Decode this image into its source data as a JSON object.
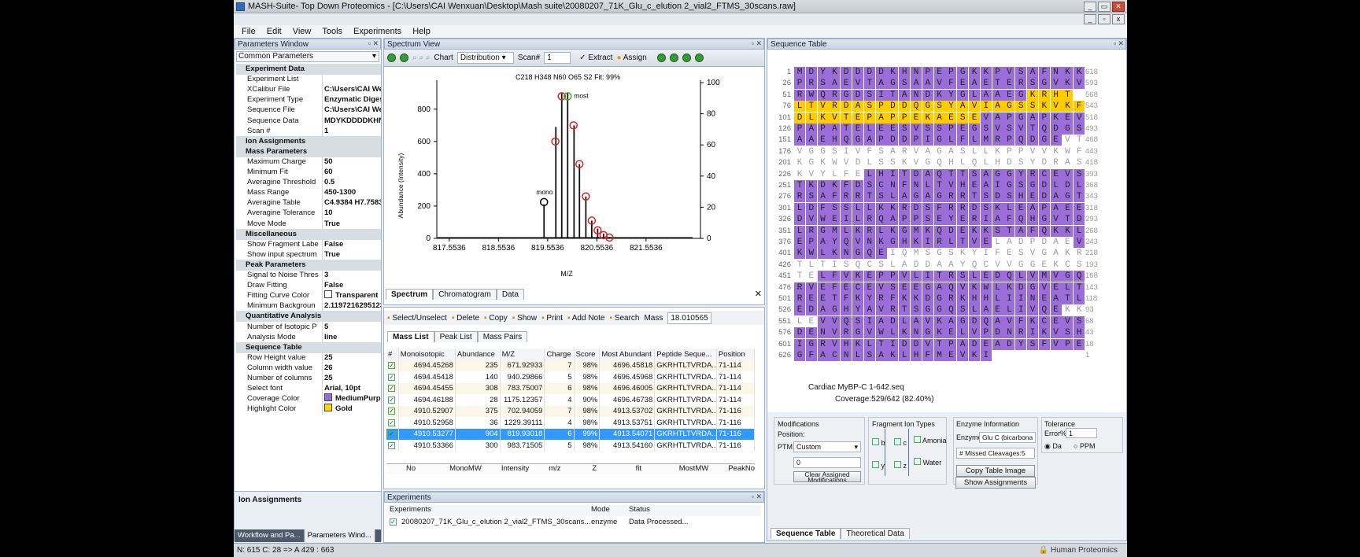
{
  "window": {
    "title": "MASH-Suite- Top Down Proteomics - [C:\\Users\\CAI Wenxuan\\Desktop\\Mash suite\\20080207_71K_Glu_c_elution 2_vial2_FTMS_30scans.raw]"
  },
  "menu": [
    "File",
    "Edit",
    "View",
    "Tools",
    "Experiments",
    "Help"
  ],
  "params": {
    "title": "Parameters Window",
    "dropdown": "Common Parameters",
    "rows": [
      {
        "s": "Experiment Data"
      },
      {
        "k": "Experiment List",
        "v": ""
      },
      {
        "k": "XCalibur File",
        "v": "C:\\Users\\CAI Wen"
      },
      {
        "k": "Experiment Type",
        "v": "Enzymatic Digesti"
      },
      {
        "k": "Sequence File",
        "v": "C:\\Users\\CAI Wen"
      },
      {
        "k": "Sequence Data",
        "v": "MDYKDDDDKHNI"
      },
      {
        "k": "Scan #",
        "v": "1"
      },
      {
        "s": "Ion Assignments"
      },
      {
        "s": "Mass Parameters"
      },
      {
        "k": "Maximum Charge",
        "v": "50"
      },
      {
        "k": "Minimum Fit",
        "v": "60"
      },
      {
        "k": "Averagine Threshold",
        "v": "0.5"
      },
      {
        "k": "Mass Range",
        "v": "450-1300"
      },
      {
        "k": "Averagine Table",
        "v": "C4.9384 H7.7583 N"
      },
      {
        "k": "Averagine Tolerance",
        "v": "10"
      },
      {
        "k": "Move Mode",
        "v": "True"
      },
      {
        "s": "Miscellaneous"
      },
      {
        "k": "Show Fragment Labe",
        "v": "False"
      },
      {
        "k": "Show input spectrum",
        "v": "True"
      },
      {
        "s": "Peak Parameters"
      },
      {
        "k": "Signal to Noise Thres",
        "v": "3"
      },
      {
        "k": "Draw Fitting",
        "v": "False"
      },
      {
        "k": "Fitting Curve Color",
        "v": "Transparent",
        "sw": "#ffffff"
      },
      {
        "k": "Minimum Backgroun",
        "v": "2.11972162951238"
      },
      {
        "s": "Quantitative Analysis"
      },
      {
        "k": "Number of Isotopic P",
        "v": "5"
      },
      {
        "k": "Analysis Mode",
        "v": "line"
      },
      {
        "s": "Sequence Table"
      },
      {
        "k": "Row Height value",
        "v": "25"
      },
      {
        "k": "Column width value",
        "v": "26"
      },
      {
        "k": "Number of columns",
        "v": "25"
      },
      {
        "k": "Select font",
        "v": "Arial, 10pt"
      },
      {
        "k": "Coverage Color",
        "v": "MediumPurple",
        "sw": "#9370db"
      },
      {
        "k": "Highlight Color",
        "v": "Gold",
        "sw": "#ffd700"
      }
    ],
    "ion_box": "Ion Assignments",
    "tabs": [
      "Workflow and Pa...",
      "Parameters Wind..."
    ]
  },
  "spectrum": {
    "title": "Spectrum View",
    "chart_label": "Chart",
    "chart_value": "Distribution",
    "scan_label": "Scan#",
    "scan_value": "1",
    "extract": "Extract",
    "assign": "Assign",
    "formula": "C218 H348 N60 O65 S2  Fit: 99%",
    "ylabel": "Abundance (Intensity)",
    "xlabel": "M/Z",
    "most": "most",
    "mono": "mono",
    "xticks": [
      "817.5536",
      "818.5536",
      "819.5536",
      "820.5536",
      "821.5536"
    ],
    "yticks_left": [
      "0",
      "200",
      "400",
      "600",
      "800"
    ],
    "yticks_right": [
      "0",
      "20",
      "40",
      "60",
      "80",
      "100"
    ],
    "tabs": [
      "Spectrum",
      "Chromatogram",
      "Data"
    ]
  },
  "chart_data": {
    "type": "scatter",
    "x_domain": [
      817.3,
      822.5
    ],
    "y_domain": [
      0,
      950
    ],
    "sticks": [
      {
        "x": 819.48,
        "y": 210
      },
      {
        "x": 819.72,
        "y": 690
      },
      {
        "x": 819.84,
        "y": 900
      },
      {
        "x": 819.96,
        "y": 900
      },
      {
        "x": 820.09,
        "y": 700
      },
      {
        "x": 820.2,
        "y": 460
      },
      {
        "x": 820.33,
        "y": 260
      },
      {
        "x": 820.45,
        "y": 110
      },
      {
        "x": 820.57,
        "y": 60
      },
      {
        "x": 820.69,
        "y": 30
      },
      {
        "x": 820.81,
        "y": 10
      }
    ],
    "circles": [
      {
        "x": 819.48,
        "y": 225
      },
      {
        "x": 819.71,
        "y": 600
      },
      {
        "x": 819.84,
        "y": 880
      },
      {
        "x": 819.96,
        "y": 880
      },
      {
        "x": 820.08,
        "y": 700
      },
      {
        "x": 820.2,
        "y": 460
      },
      {
        "x": 820.33,
        "y": 260
      },
      {
        "x": 820.45,
        "y": 110
      },
      {
        "x": 820.57,
        "y": 50
      },
      {
        "x": 820.69,
        "y": 20
      },
      {
        "x": 820.81,
        "y": 5
      }
    ]
  },
  "mass": {
    "toolbar": [
      "Select/Unselect",
      "Delete",
      "Copy",
      "Show",
      "Print",
      "Add Note",
      "Search"
    ],
    "mass_label": "Mass",
    "mass_value": "18.010565",
    "tabs": [
      "Mass List",
      "Peak List",
      "Mass Pairs"
    ],
    "headers": [
      "#",
      "Monoisotopic",
      "Abundance",
      "M/Z",
      "Charge",
      "Score",
      "Most Abundant",
      "Peptide Seque...",
      "Position"
    ],
    "rows": [
      [
        "4694.45268",
        "235",
        "671.92933",
        "7",
        "98%",
        "4696.45818",
        "GKRHTLTVRDA...",
        "71-114"
      ],
      [
        "4694.45418",
        "140",
        "940.29866",
        "5",
        "98%",
        "4696.45968",
        "GKRHTLTVRDA...",
        "71-114"
      ],
      [
        "4694.45455",
        "308",
        "783.75007",
        "6",
        "98%",
        "4696.46005",
        "GKRHTLTVRDA...",
        "71-114"
      ],
      [
        "4694.46188",
        "28",
        "1175.12357",
        "4",
        "90%",
        "4696.46738",
        "GKRHTLTVRDA...",
        "71-114"
      ],
      [
        "4910.52907",
        "375",
        "702.94059",
        "7",
        "98%",
        "4913.53702",
        "GKRHTLTVRDA...",
        "71-116"
      ],
      [
        "4910.52958",
        "36",
        "1229.39111",
        "4",
        "98%",
        "4913.53751",
        "GKRHTLTVRDA...",
        "71-116"
      ],
      [
        "4910.53277",
        "904",
        "819.93018",
        "6",
        "99%",
        "4913.54071",
        "GKRHTLTVRDA...",
        "71-116"
      ],
      [
        "4910.53366",
        "300",
        "983.71505",
        "5",
        "98%",
        "4913.54160",
        "GKRHTLTVRDA...",
        "71-116"
      ]
    ],
    "selected_row": 6,
    "footer": [
      "No",
      "MonoMW",
      "Intensity",
      "m/z",
      "Z",
      "fit",
      "MostMW",
      "PeakNo"
    ]
  },
  "experiments": {
    "title": "Experiments",
    "headers": [
      "Experiments",
      "Mode",
      "Status"
    ],
    "row": [
      "20080207_71K_Glu_c_elution 2_vial2_FTMS_30scans...",
      "enzyme",
      "Data Processed..."
    ]
  },
  "seq": {
    "title": "Sequence Table",
    "rows": [
      {
        "n": "1",
        "r": "618",
        "s": "MDYKDDDDKHNPEPGKKPVSAFNKK",
        "m": "ccccccccccccccccccccccccc"
      },
      {
        "n": "26",
        "r": "593",
        "s": "PRSAEVTAGSAAVFEAETERSGVKV",
        "m": "ccccccccccccccccccccccccc"
      },
      {
        "n": "51",
        "r": "568",
        "s": "RWQRGDSITANDKYGLAAEGKRHT",
        "m": "cccccccccccccccccccchhhh"
      },
      {
        "n": "76",
        "r": "543",
        "s": "LTVRDASPDDQGSYAVIAGSSKVKF",
        "m": "hhhhhhhhhhhhhhhhhhhhhhhhh"
      },
      {
        "n": "101",
        "r": "518",
        "s": "DLKVTEPAPPEKAESEVAPGAPKEV",
        "m": "hhhhhhhhhhhhhhhhccccccccc"
      },
      {
        "n": "126",
        "r": "493",
        "s": "PAPATELEESVSSPEGSVSVTQDGS",
        "m": "ccccccccccccccccccccccccc"
      },
      {
        "n": "151",
        "r": "468",
        "s": "AAEHQGAPDDPIGLFLMRPQDGEVT",
        "m": "cccccccccccccccccccccccnn"
      },
      {
        "n": "176",
        "r": "443",
        "s": "VGGSIVFSARVAGASLLKPPVVKWF",
        "m": "nnnnnnnnnnnnnnnnnnnnnnnnn"
      },
      {
        "n": "201",
        "r": "418",
        "s": "KGKWVDLSSKVGQHLQLHDSYDRAS",
        "m": "nnnnnnnnnnnnnnnnnnnnnnnnn"
      },
      {
        "n": "226",
        "r": "393",
        "s": "KVYLFELHITDAQTTSAGGYRCEVS",
        "m": "nnnnnnccccccccccccccccccc"
      },
      {
        "n": "251",
        "r": "368",
        "s": "TKDKFDSCNFNLTVHEAIGSGDLDL",
        "m": "ccccccccccccccccccccccccc"
      },
      {
        "n": "276",
        "r": "343",
        "s": "RSAFRRTSLAGAGRRTSDSHEDAGT",
        "m": "ccccccccccccccccccccccccc"
      },
      {
        "n": "301",
        "r": "318",
        "s": "LDFSSLLKKRDSFRRDSKLEAPAEE",
        "m": "ccccccccccccccccccccccccc"
      },
      {
        "n": "326",
        "r": "293",
        "s": "DVWEILRQAPPSEYERIAFQHGVTD",
        "m": "ccccccccccccccccccccccccc"
      },
      {
        "n": "351",
        "r": "268",
        "s": "LRGMLKRLKGMKQDEKKSTAFQKKL",
        "m": "ccccccccccccccccccccccccc"
      },
      {
        "n": "376",
        "r": "243",
        "s": "EPAYQVNKGHKIRLTVELADPDAEV",
        "m": "cccccccccccccccccnnnnnnnc"
      },
      {
        "n": "401",
        "r": "218",
        "s": "KWLKNGQEIQMSGSKYIFESVGAKR",
        "m": "ccccccccnnnnnnnnnnnnnnnnn"
      },
      {
        "n": "426",
        "r": "193",
        "s": "TLTISQCSLADDAAYQCVVGGEKCS",
        "m": "nnnnnnnnnnnnnnnnnnnnnnnnn"
      },
      {
        "n": "451",
        "r": "168",
        "s": "TELFVKEPPVLITRSLEDQLVMVGQ",
        "m": "nnccccccccccccccccccccccc"
      },
      {
        "n": "476",
        "r": "143",
        "s": "RVEFECEVSEEGAQVKWLKDGVELT",
        "m": "ccccccccccccccccccccccccc"
      },
      {
        "n": "501",
        "r": "118",
        "s": "REETFKYRFKKDGRKHHLIINEATL",
        "m": "ccccccccccccccccccccccccc"
      },
      {
        "n": "526",
        "r": "93",
        "s": "EDAGHYAVRTSGGQSLAELIVQEKK",
        "m": "cccccccccccccccccccccccnn"
      },
      {
        "n": "551",
        "r": "68",
        "s": "LEVVQSIADLAVKAGDQAVFKCEVS",
        "m": "nnccccccccccccccccccccccc"
      },
      {
        "n": "576",
        "r": "43",
        "s": "DENVRGVWLKNGKELVPDNRIKVSH",
        "m": "ccccccccccccccccccccccccc"
      },
      {
        "n": "601",
        "r": "18",
        "s": "IGRVHKLTIDDVTPADEADYSFVPE",
        "m": "ccccccccccccccccccccccccc"
      },
      {
        "n": "626",
        "r": "1",
        "s": "GFACNLSAKLHFMEVKI",
        "m": "ccccccccccccccccc"
      }
    ],
    "name": "Cardiac MyBP-C 1-642.seq",
    "coverage": "Coverage:529/642 (82.40%)",
    "mods": {
      "title": "Modifications",
      "position": "Position:",
      "ptm_label": "PTM:",
      "ptm": "Custom",
      "value": "0",
      "clear": "Clear Assigned Modifications"
    },
    "frag": {
      "title": "Fragment Ion Types",
      "b": "b",
      "c": "c",
      "y": "y",
      "z": "z",
      "amonia": "Amonia",
      "water": "Water"
    },
    "enzyme": {
      "title": "Enzyme Information",
      "label": "Enzyme",
      "value": "Glu C (bicarbona",
      "missed": "# Missed Cleavages:5",
      "copy": "Copy Table Image",
      "show": "Show Assignments"
    },
    "tol": {
      "title": "Tolerance",
      "error": "Error%",
      "value": "1",
      "da": "Da",
      "ppm": "PPM"
    },
    "tabs": [
      "Sequence Table",
      "Theoretical Data"
    ]
  },
  "status": {
    "text": "N: 615 C: 28 => A  429 : 663",
    "right": "Human Proteomics"
  }
}
